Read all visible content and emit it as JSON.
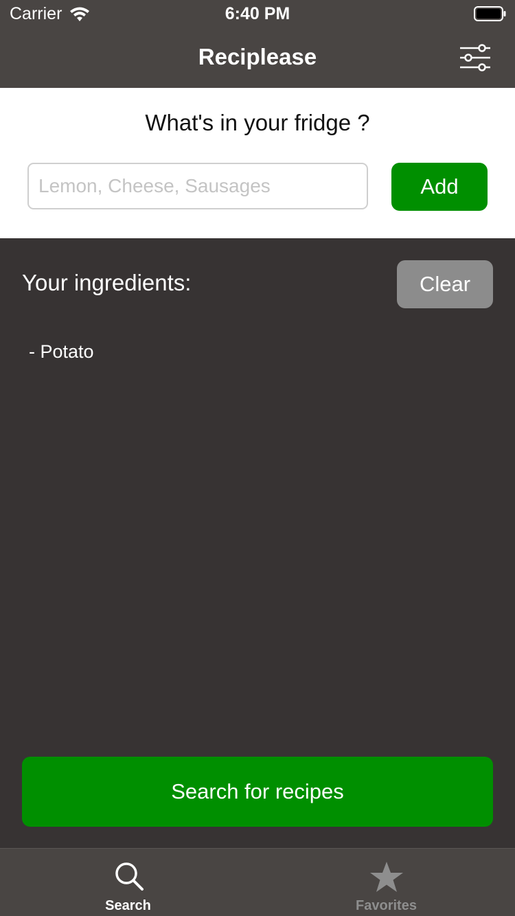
{
  "status_bar": {
    "carrier": "Carrier",
    "time": "6:40 PM",
    "wifi_icon": "wifi-icon",
    "battery_icon": "battery-icon"
  },
  "nav_bar": {
    "title": "Reciplease",
    "filter_icon": "sliders-icon"
  },
  "input_panel": {
    "question": "What's in your fridge ?",
    "input_placeholder": "Lemon, Cheese, Sausages",
    "input_value": "",
    "add_label": "Add"
  },
  "ingredients": {
    "heading": "Your ingredients:",
    "clear_label": "Clear",
    "items": [
      "- Potato"
    ]
  },
  "search_button_label": "Search for recipes",
  "tab_bar": {
    "tabs": [
      {
        "label": "Search",
        "icon": "magnifier-icon",
        "selected": true
      },
      {
        "label": "Favorites",
        "icon": "star-icon",
        "selected": false
      }
    ]
  },
  "colors": {
    "nav_background": "#494543",
    "content_background": "#373333",
    "accent_green": "#008f00",
    "clear_gray": "#8c8c8c",
    "inactive_tab": "#8e8e8e"
  }
}
